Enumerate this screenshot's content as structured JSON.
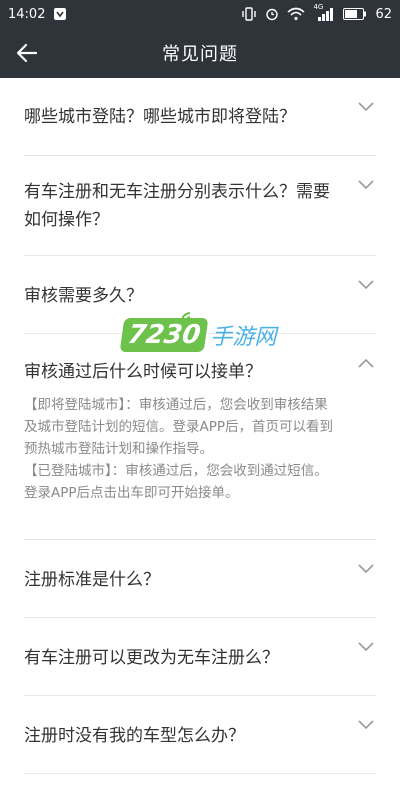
{
  "status_bar": {
    "time": "14:02",
    "battery": "62",
    "network": "4G"
  },
  "header": {
    "title": "常见问题"
  },
  "faq": [
    {
      "question": "哪些城市登陆？哪些城市即将登陆？",
      "expanded": false
    },
    {
      "question": "有车注册和无车注册分别表示什么？需要如何操作？",
      "expanded": false
    },
    {
      "question": "审核需要多久？",
      "expanded": false
    },
    {
      "question": "审核通过后什么时候可以接单？",
      "expanded": true,
      "answer_lines": [
        "【即将登陆城市】：审核通过后，您会收到审核结果",
        "及城市登陆计划的短信。登录APP后，首页可以看到",
        "预热城市登陆计划和操作指导。",
        "【已登陆城市】：审核通过后，您会收到通过短信。",
        "登录APP后点击出车即可开始接单。"
      ]
    },
    {
      "question": "注册标准是什么？",
      "expanded": false
    },
    {
      "question": "有车注册可以更改为无车注册么？",
      "expanded": false
    },
    {
      "question": "注册时没有我的车型怎么办？",
      "expanded": false
    }
  ],
  "watermark": {
    "number": "7230",
    "text": "手游网"
  },
  "icons": {
    "back": "arrow-left-icon",
    "collapsed": "chevron-down-icon",
    "expanded": "chevron-up-icon"
  },
  "colors": {
    "bar_bg": "#2f343a",
    "answer_text": "#8a8a8a",
    "divider": "#e8e8e8"
  }
}
